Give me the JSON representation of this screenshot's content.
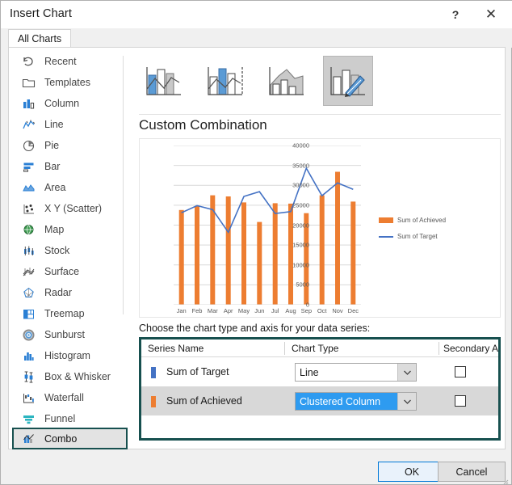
{
  "window": {
    "title": "Insert Chart",
    "help_icon": "question-mark-icon",
    "help_label": "?",
    "close_icon": "close-icon",
    "close_label": "✕"
  },
  "tabs": [
    {
      "label": "All Charts",
      "selected": true
    }
  ],
  "sidebar": {
    "items": [
      {
        "label": "Recent",
        "icon": "recent-undo-icon",
        "selected": false
      },
      {
        "label": "Templates",
        "icon": "folder-icon",
        "selected": false
      },
      {
        "label": "Column",
        "icon": "column-chart-icon",
        "selected": false
      },
      {
        "label": "Line",
        "icon": "line-chart-icon",
        "selected": false
      },
      {
        "label": "Pie",
        "icon": "pie-chart-icon",
        "selected": false
      },
      {
        "label": "Bar",
        "icon": "bar-chart-icon",
        "selected": false
      },
      {
        "label": "Area",
        "icon": "area-chart-icon",
        "selected": false
      },
      {
        "label": "X Y (Scatter)",
        "icon": "scatter-chart-icon",
        "selected": false
      },
      {
        "label": "Map",
        "icon": "map-globe-icon",
        "selected": false
      },
      {
        "label": "Stock",
        "icon": "stock-chart-icon",
        "selected": false
      },
      {
        "label": "Surface",
        "icon": "surface-chart-icon",
        "selected": false
      },
      {
        "label": "Radar",
        "icon": "radar-chart-icon",
        "selected": false
      },
      {
        "label": "Treemap",
        "icon": "treemap-icon",
        "selected": false
      },
      {
        "label": "Sunburst",
        "icon": "sunburst-icon",
        "selected": false
      },
      {
        "label": "Histogram",
        "icon": "histogram-icon",
        "selected": false
      },
      {
        "label": "Box & Whisker",
        "icon": "box-whisker-icon",
        "selected": false
      },
      {
        "label": "Waterfall",
        "icon": "waterfall-icon",
        "selected": false
      },
      {
        "label": "Funnel",
        "icon": "funnel-icon",
        "selected": false
      },
      {
        "label": "Combo",
        "icon": "combo-chart-icon",
        "selected": true
      }
    ]
  },
  "gallery": {
    "thumbnails": [
      {
        "name": "clustered-column-line",
        "selected": false
      },
      {
        "name": "clustered-column-line-on-secondary-axis",
        "selected": false
      },
      {
        "name": "stacked-area-clustered-column",
        "selected": false
      },
      {
        "name": "custom-combination",
        "selected": true
      }
    ]
  },
  "preview": {
    "title": "Custom Combination"
  },
  "chart_data": {
    "type": "bar",
    "title": "Custom Combination",
    "xlabel": "",
    "ylabel": "",
    "ylim": [
      0,
      40000
    ],
    "yticks": [
      0,
      5000,
      10000,
      15000,
      20000,
      25000,
      30000,
      35000,
      40000
    ],
    "ytick_labels": [
      "0",
      "5000",
      "10000",
      "15000",
      "20000",
      "25000",
      "30000",
      "35000",
      "40000"
    ],
    "grid": true,
    "legend_position": "right",
    "categories": [
      "Jan",
      "Feb",
      "Mar",
      "Apr",
      "May",
      "Jun",
      "Jul",
      "Aug",
      "Sep",
      "Oct",
      "Nov",
      "Dec"
    ],
    "series": [
      {
        "name": "Sum of Achieved",
        "type": "bar",
        "color": "#ed7d31",
        "values": [
          23800,
          24800,
          27500,
          27200,
          25700,
          20800,
          25500,
          25400,
          23000,
          27500,
          33400,
          25900
        ]
      },
      {
        "name": "Sum of Target",
        "type": "line",
        "color": "#4472c4",
        "values": [
          23100,
          24900,
          23900,
          18200,
          27200,
          28400,
          22900,
          23400,
          34300,
          27400,
          30600,
          29000
        ]
      }
    ]
  },
  "series_section": {
    "instruction": "Choose the chart type and axis for your data series:",
    "columns": [
      "Series Name",
      "Chart Type",
      "Secondary Axis"
    ],
    "rows": [
      {
        "series_name": "Sum of Target",
        "swatch_color": "#4472c4",
        "chart_type": "Line",
        "chart_type_highlighted": false,
        "secondary_axis_checked": false
      },
      {
        "series_name": "Sum of Achieved",
        "swatch_color": "#ed7d31",
        "chart_type": "Clustered Column",
        "chart_type_highlighted": true,
        "secondary_axis_checked": false
      }
    ]
  },
  "footer": {
    "ok_label": "OK",
    "cancel_label": "Cancel"
  },
  "colors": {
    "accent_teal": "#17504f",
    "series_orange": "#ed7d31",
    "series_blue": "#4472c4",
    "selection_blue": "#2e9bf0",
    "focus_blue": "#0078d7"
  }
}
